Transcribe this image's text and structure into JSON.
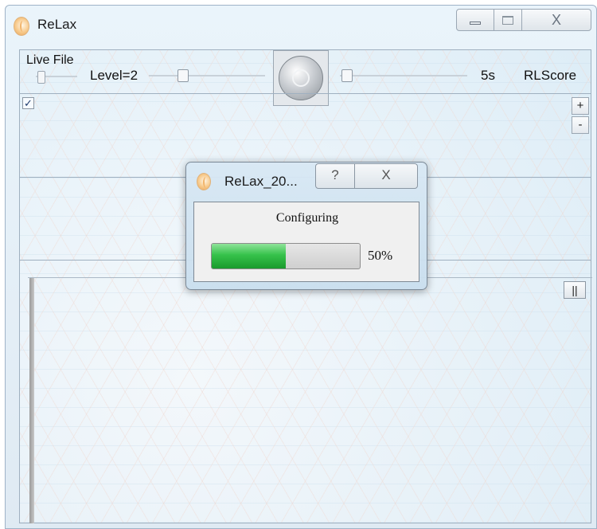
{
  "window": {
    "title": "ReLax",
    "close_glyph": "X"
  },
  "toolbar": {
    "live_file_label": "Live File",
    "level_label": "Level=2",
    "duration_label": "5s",
    "rlscore_label": "RLScore"
  },
  "upper_pane": {
    "checkbox_checked": true,
    "checkbox_glyph": "✓",
    "zoom_in_label": "+",
    "zoom_out_label": "-"
  },
  "lower_pane": {
    "pause_label": "||"
  },
  "dialog": {
    "title": "ReLax_20...",
    "help_glyph": "?",
    "close_glyph": "X",
    "message": "Configuring",
    "progress": 0.5,
    "progress_label": "50%"
  }
}
